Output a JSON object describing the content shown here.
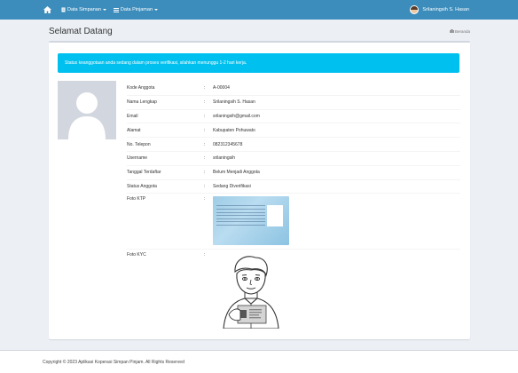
{
  "nav": {
    "home_icon": "home-icon",
    "data_simpanan": "Data Simpanan",
    "data_pinjaman": "Data Pinjaman",
    "user_name": "Srilaningsih S. Hasan"
  },
  "header": {
    "title": "Selamat Datang",
    "breadcrumb": "Beranda"
  },
  "alert": {
    "text": "Status keanggotaan anda sedang dalam proses verifikasi, silahkan menunggu 1-2 hari kerja."
  },
  "profile": {
    "rows": [
      {
        "label": "Kode Anggota",
        "value": "A-00004"
      },
      {
        "label": "Nama Lengkap",
        "value": "Srilaningsih S. Hasan"
      },
      {
        "label": "Email",
        "value": "srilaningsih@gmail.com"
      },
      {
        "label": "Alamat",
        "value": "Kabupaten Pohuwato"
      },
      {
        "label": "No. Telepon",
        "value": "082312345678"
      },
      {
        "label": "Username",
        "value": "srilaningsih"
      },
      {
        "label": "Tanggal Terdaftar",
        "value": "Belum Menjadi Anggota"
      },
      {
        "label": "Status Anggota",
        "value": "Sedang Diverifikasi"
      }
    ],
    "separator": ":",
    "foto_ktp_label": "Foto KTP",
    "foto_kyc_label": "Foto KYC"
  },
  "footer": {
    "text": "Copyright © 2023 Aplikasi Koperasi Simpan Pinjam. All Rights Reserved"
  },
  "colors": {
    "topbar": "#3c8dbc",
    "alert": "#00c0ef",
    "background": "#ecf0f5"
  }
}
